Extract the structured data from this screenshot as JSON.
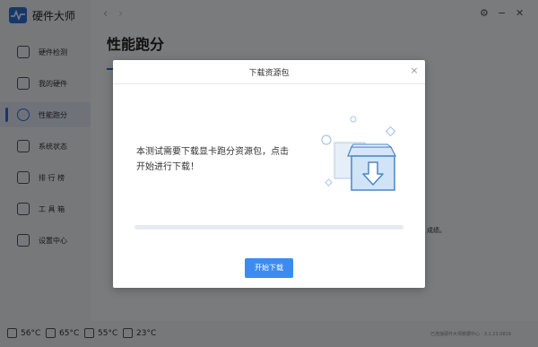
{
  "app": {
    "name": "硬件大师"
  },
  "sidebar": {
    "items": [
      {
        "label": "硬件检测",
        "icon": "monitor-icon"
      },
      {
        "label": "我的硬件",
        "icon": "computer-icon"
      },
      {
        "label": "性能跑分",
        "icon": "gauge-icon",
        "active": true
      },
      {
        "label": "系统状态",
        "icon": "gear-icon"
      },
      {
        "label": "排 行 榜",
        "icon": "ranking-icon"
      },
      {
        "label": "工 具 箱",
        "icon": "toolbox-icon"
      },
      {
        "label": "设置中心",
        "icon": "settings-icon"
      }
    ]
  },
  "header": {
    "back": "‹",
    "forward": "›",
    "settings": "⚙",
    "minimize": "−",
    "close": "✕"
  },
  "page": {
    "title": "性能跑分",
    "bg_hint": "成绩。"
  },
  "statusbar": {
    "temps": [
      {
        "icon": "cpu-temp-icon",
        "value": "56°C"
      },
      {
        "icon": "gpu-temp-icon",
        "value": "65°C"
      },
      {
        "icon": "board-temp-icon",
        "value": "55°C"
      },
      {
        "icon": "disk-temp-icon",
        "value": "23°C"
      }
    ],
    "version": "已连接硬件大师数据中心 · 3.1.23.0819"
  },
  "modal": {
    "title": "下载资源包",
    "close": "×",
    "message": "本测试需要下载显卡跑分资源包，点击开始进行下载！",
    "progress": 0,
    "button": "开始下载"
  },
  "colors": {
    "accent": "#3c8cf0",
    "brand": "#2f6fd6"
  }
}
